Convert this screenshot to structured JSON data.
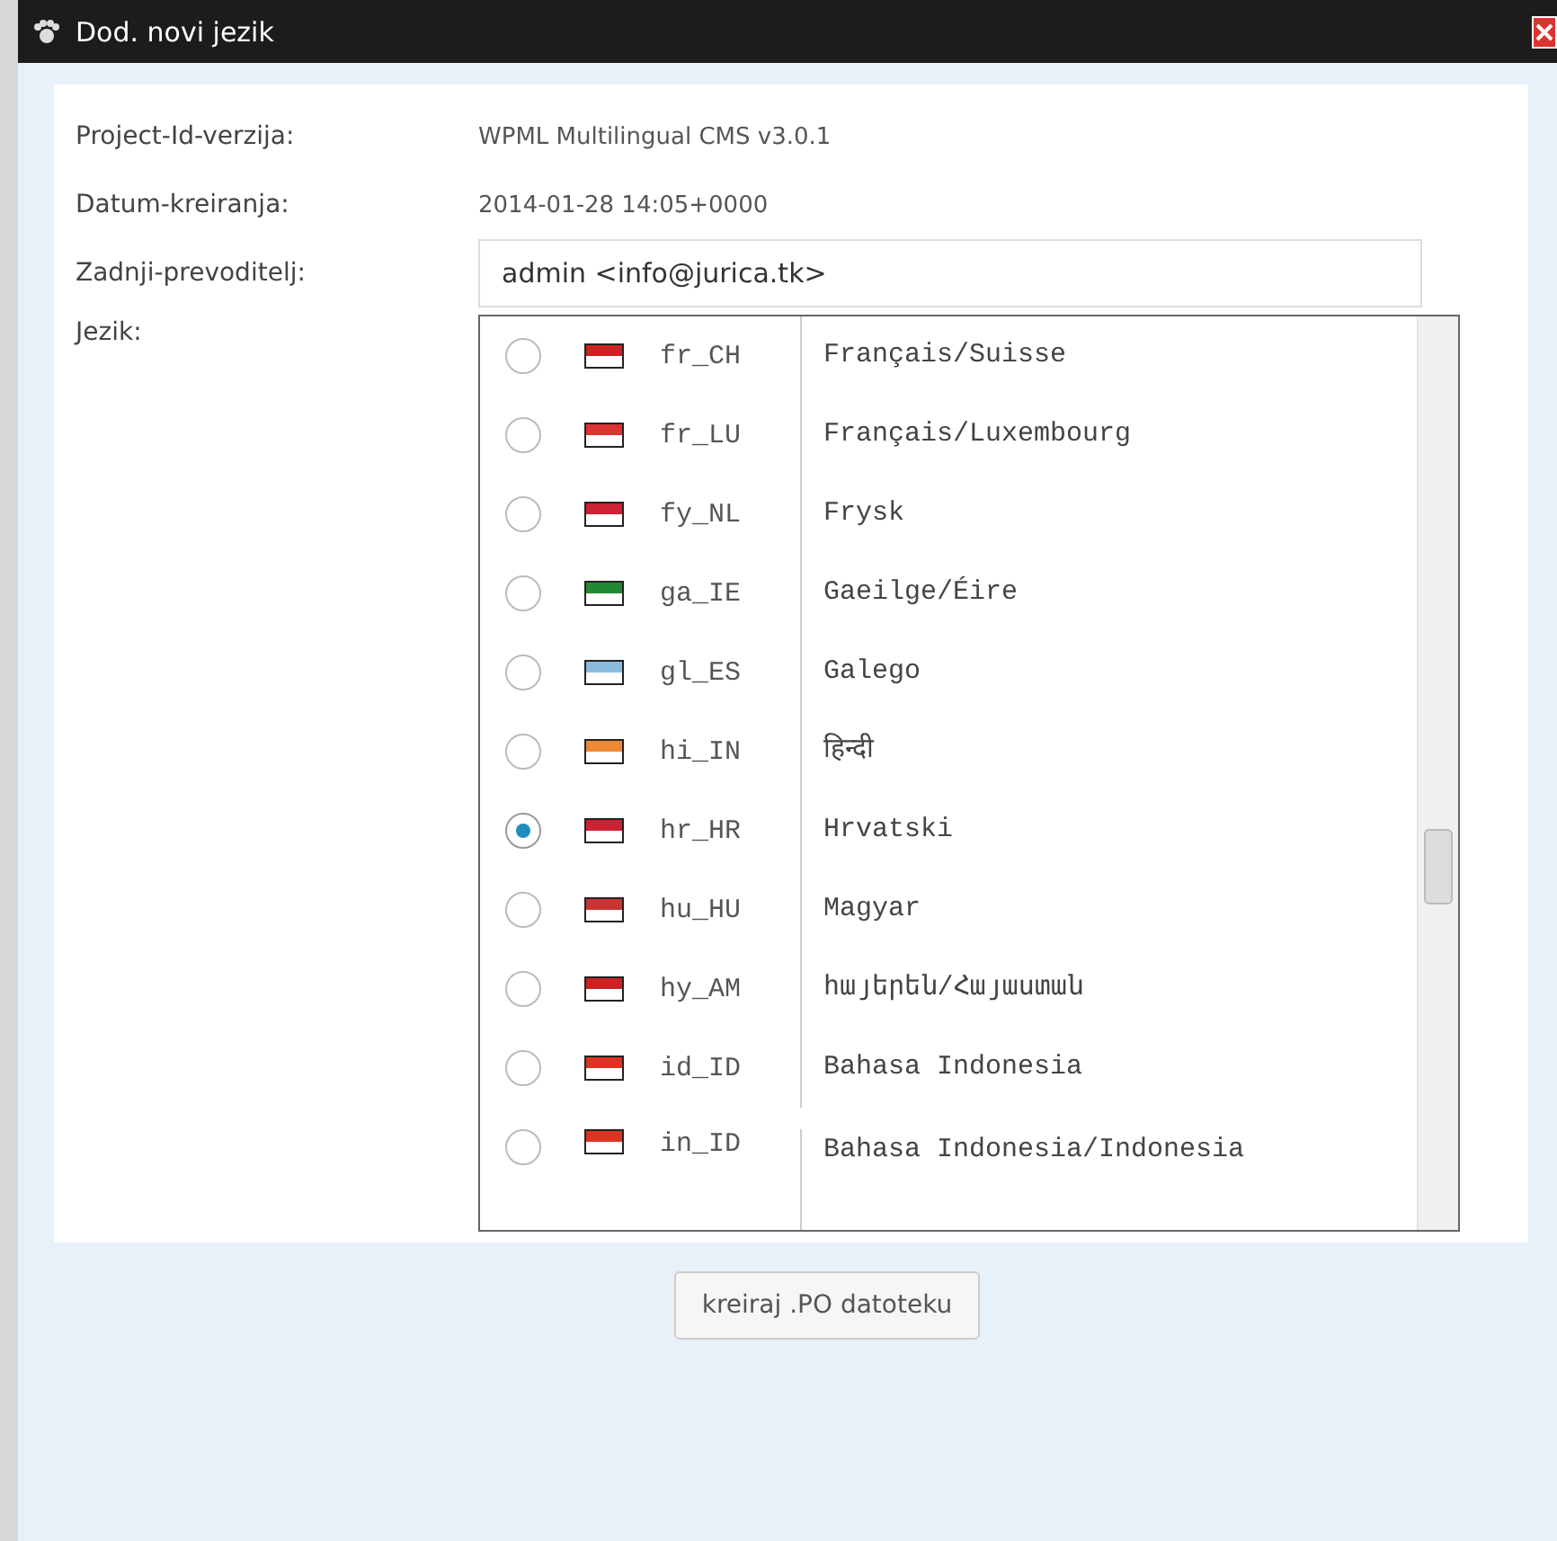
{
  "window": {
    "title": "Dod. novi jezik"
  },
  "fields": [
    {
      "label": "Project-Id-verzija:",
      "value": "WPML Multilingual CMS v3.0.1"
    },
    {
      "label": "Datum-kreiranja:",
      "value": "2014-01-28 14:05+0000"
    }
  ],
  "translator": {
    "label": "Zadnji-prevoditelj:",
    "value": "admin <info@jurica.tk>"
  },
  "language": {
    "label": "Jezik:",
    "items": [
      {
        "code": "fr_CH",
        "name": "Français/Suisse",
        "selected": false,
        "color": "#cc2222"
      },
      {
        "code": "fr_LU",
        "name": "Français/Luxembourg",
        "selected": false,
        "color": "#dd3333"
      },
      {
        "code": "fy_NL",
        "name": "Frysk",
        "selected": false,
        "color": "#cc2233"
      },
      {
        "code": "ga_IE",
        "name": "Gaeilge/Éire",
        "selected": false,
        "color": "#228833"
      },
      {
        "code": "gl_ES",
        "name": "Galego",
        "selected": false,
        "color": "#88bbdd"
      },
      {
        "code": "hi_IN",
        "name": "हिन्दी",
        "selected": false,
        "color": "#ee8833"
      },
      {
        "code": "hr_HR",
        "name": "Hrvatski",
        "selected": true,
        "color": "#cc2233"
      },
      {
        "code": "hu_HU",
        "name": "Magyar",
        "selected": false,
        "color": "#cc3333"
      },
      {
        "code": "hy_AM",
        "name": "հայերեն/Հայաստան",
        "selected": false,
        "color": "#cc2222"
      },
      {
        "code": "id_ID",
        "name": "Bahasa Indonesia",
        "selected": false,
        "color": "#dd3322"
      },
      {
        "code": "in_ID",
        "name": "Bahasa Indonesia/Indonesia",
        "selected": false,
        "color": "#dd3322"
      }
    ]
  },
  "button": "kreiraj .PO datoteku"
}
